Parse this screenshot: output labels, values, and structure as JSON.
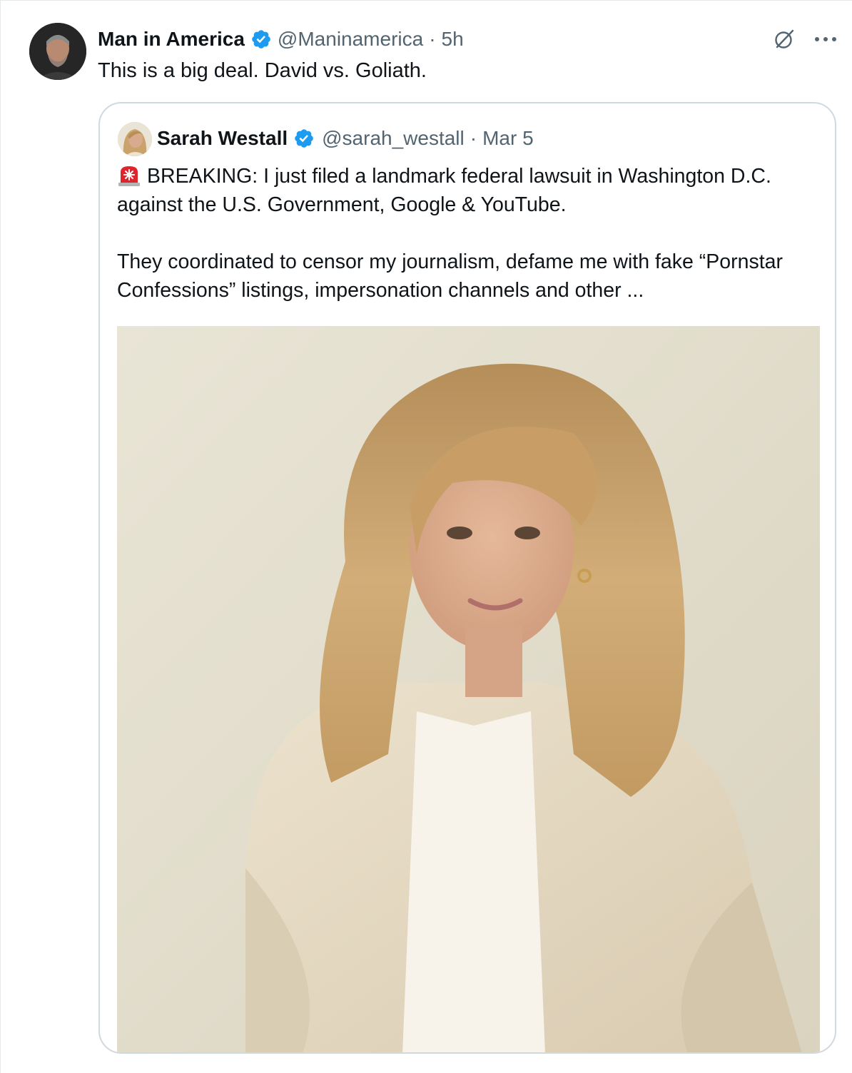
{
  "tweet": {
    "author": {
      "display_name": "Man in America",
      "handle": "@Maninamerica",
      "verified": true
    },
    "separator": "·",
    "time": "5h",
    "text": "This is a big deal. David vs. Goliath.",
    "actions": {
      "grok_icon": "grok-icon",
      "more_icon": "more-icon"
    }
  },
  "quoted_tweet": {
    "author": {
      "display_name": "Sarah Westall",
      "handle": "@sarah_westall",
      "verified": true
    },
    "separator": "·",
    "time": "Mar 5",
    "emoji": "siren-emoji",
    "paragraph_1": "BREAKING: I just filed a landmark federal lawsuit in Washington D.C. against the U.S. Government, Google & YouTube.",
    "paragraph_2": "They coordinated to censor my journalism, defame me with fake “Pornstar Confessions” listings, impersonation channels and other ...",
    "media": {
      "type": "photo",
      "subject": "portrait-photo"
    }
  },
  "colors": {
    "primary_text": "#0f1419",
    "secondary_text": "#536471",
    "verified_blue": "#1d9bf0",
    "border": "#cfd9de"
  }
}
